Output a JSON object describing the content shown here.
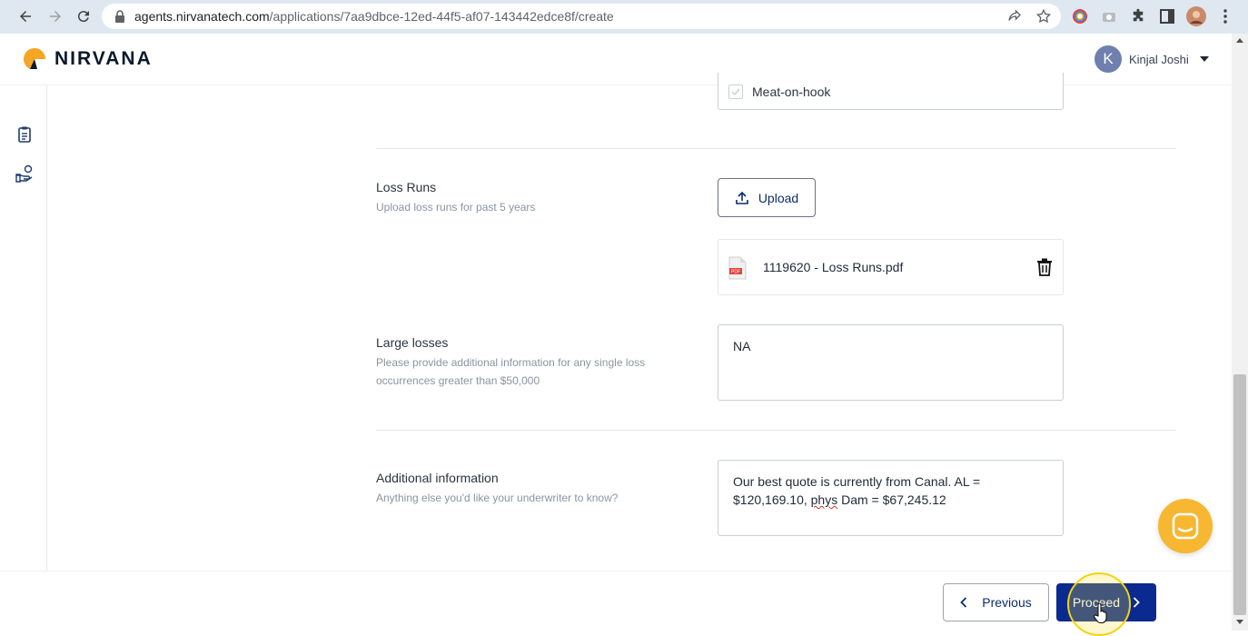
{
  "browser": {
    "url_host": "agents.nirvanatech.com",
    "url_path": "/applications/7aa9dbce-12ed-44f5-af07-143442edce8f/create"
  },
  "header": {
    "logo_text": "NIRVANA",
    "user_initial": "K",
    "user_name": "Kinjal Joshi"
  },
  "form": {
    "commodity_checkbox_label": "Meat-on-hook",
    "loss_runs": {
      "label": "Loss Runs",
      "help": "Upload loss runs for past 5 years",
      "upload_label": "Upload",
      "file_name": "1119620 - Loss Runs.pdf",
      "file_type": "PDF"
    },
    "large_losses": {
      "label": "Large losses",
      "help_line1": "Please provide additional information for any single loss",
      "help_line2": "occurrences greater than $50,000",
      "value": "NA"
    },
    "additional_info": {
      "label": "Additional information",
      "help": "Anything else you'd like your underwriter to know?",
      "value_line1": "Our best quote is currently from Canal. AL =",
      "value_line2_a": "$120,169.10, ",
      "value_line2_misspelled": "phys",
      "value_line2_b": " Dam = $67,245.12"
    }
  },
  "footer": {
    "previous_label": "Previous",
    "proceed_label": "Proceed"
  },
  "colors": {
    "primary": "#0a2a8f",
    "chat_bubble": "#f7b731",
    "logo_orange": "#f5a623"
  }
}
